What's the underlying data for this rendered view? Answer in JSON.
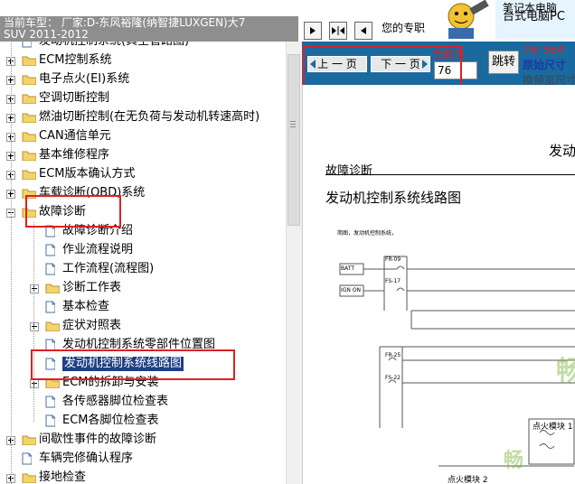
{
  "window": {
    "title_line1": "当前车型：  厂家:D-东风裕隆(纳智捷LUXGEN)大7",
    "title_line2": "SUV 2011-2012"
  },
  "tree": {
    "items": [
      {
        "label": "发动机控制系统(真空管路图)",
        "icon": "doc-icon",
        "level": 1,
        "expand": "none"
      },
      {
        "label": "ECM控制系统",
        "icon": "folder-icon",
        "level": 1,
        "expand": "plus"
      },
      {
        "label": "电子点火(EI)系统",
        "icon": "folder-icon",
        "level": 1,
        "expand": "plus"
      },
      {
        "label": "空调切断控制",
        "icon": "folder-icon",
        "level": 1,
        "expand": "plus"
      },
      {
        "label": "燃油切断控制(在无负荷与发动机转速高时)",
        "icon": "folder-icon",
        "level": 1,
        "expand": "plus"
      },
      {
        "label": "CAN通信单元",
        "icon": "folder-icon",
        "level": 1,
        "expand": "plus"
      },
      {
        "label": "基本维修程序",
        "icon": "folder-icon",
        "level": 1,
        "expand": "plus"
      },
      {
        "label": "ECM版本确认方式",
        "icon": "folder-icon",
        "level": 1,
        "expand": "plus"
      },
      {
        "label": "车载诊断(OBD)系统",
        "icon": "folder-icon",
        "level": 1,
        "expand": "plus"
      },
      {
        "label": "故障诊断",
        "icon": "folder-open-icon",
        "level": 1,
        "expand": "minus"
      },
      {
        "label": "故障诊断介绍",
        "icon": "doc-icon",
        "level": 2,
        "expand": "none"
      },
      {
        "label": "作业流程说明",
        "icon": "doc-icon",
        "level": 2,
        "expand": "none"
      },
      {
        "label": "工作流程(流程图)",
        "icon": "doc-icon",
        "level": 2,
        "expand": "none"
      },
      {
        "label": "诊断工作表",
        "icon": "folder-icon",
        "level": 2,
        "expand": "plus"
      },
      {
        "label": "基本检查",
        "icon": "doc-icon",
        "level": 2,
        "expand": "none"
      },
      {
        "label": "症状对照表",
        "icon": "folder-icon",
        "level": 2,
        "expand": "plus"
      },
      {
        "label": "发动机控制系统零部件位置图",
        "icon": "doc-icon",
        "level": 2,
        "expand": "none"
      },
      {
        "label": "发动机控制系统线路图",
        "icon": "doc-icon",
        "level": 2,
        "expand": "none",
        "selected": true
      },
      {
        "label": "ECM的拆卸与安装",
        "icon": "folder-icon",
        "level": 2,
        "expand": "plus"
      },
      {
        "label": "各传感器脚位检查表",
        "icon": "doc-icon",
        "level": 2,
        "expand": "none"
      },
      {
        "label": "ECM各脚位检查表",
        "icon": "doc-icon",
        "level": 2,
        "expand": "none"
      },
      {
        "label": "间歇性事件的故障诊断",
        "icon": "folder-icon",
        "level": 1,
        "expand": "plus"
      },
      {
        "label": "车辆完修确认程序",
        "icon": "doc-icon",
        "level": 1,
        "expand": "none"
      },
      {
        "label": "接地检查",
        "icon": "folder-icon",
        "level": 1,
        "expand": "plus"
      }
    ]
  },
  "viewer": {
    "toolbar_text": "您的专职",
    "ad_line1": "笔记本电脑",
    "ad_line2": "台式电脑PC",
    "prev_label": "上 一 页",
    "next_label": "下 一 页",
    "current_page_label": "当前为",
    "current_page_value": "76",
    "jump_label": "跳转",
    "page_count": "76/ 564",
    "page_count_suffix": "当",
    "original_size": "原始尺寸",
    "preview_size": "换预览尺寸",
    "doc": {
      "header_right": "发动",
      "section": "故障诊断",
      "heading": "发动机控制系统线路图",
      "note": "简图，发动机控制系统，",
      "batt": "BATT",
      "ign": "IGN ON",
      "fr09": "FR-09",
      "fs17": "FS-17",
      "fr25": "FR-25",
      "fs22": "FS-22",
      "ignition_module1": "点火模块 1",
      "ignition_module2": "点火模块 2",
      "watermark": "畅"
    },
    "accent_color": "#1a6aa0",
    "highlight_color": "#e02020"
  }
}
